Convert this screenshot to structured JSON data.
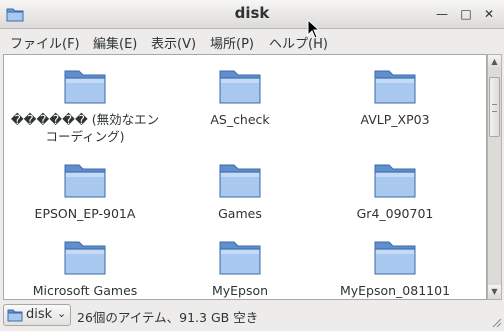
{
  "window": {
    "title": "disk"
  },
  "icons": {
    "folder": "folder-icon",
    "minimize": "minimize-icon",
    "maximize": "maximize-icon",
    "close": "close-icon"
  },
  "colors": {
    "folder_light": "#a8c8ef",
    "folder_dark": "#5f8fcc",
    "folder_edge": "#3d6aa8"
  },
  "window_controls": {
    "minimize": "—",
    "maximize": "□",
    "close": "✕"
  },
  "menu": [
    {
      "label": "ファイル(F)"
    },
    {
      "label": "編集(E)"
    },
    {
      "label": "表示(V)"
    },
    {
      "label": "場所(P)"
    },
    {
      "label": "ヘルプ(H)"
    }
  ],
  "files": [
    {
      "name": "������ (無効なエンコーディング)"
    },
    {
      "name": "AS_check"
    },
    {
      "name": "AVLP_XP03"
    },
    {
      "name": "EPSON_EP-901A"
    },
    {
      "name": "Games"
    },
    {
      "name": "Gr4_090701"
    },
    {
      "name": "Microsoft Games"
    },
    {
      "name": "MyEpson"
    },
    {
      "name": "MyEpson_081101"
    }
  ],
  "scrollbar": {
    "up": "▲",
    "down": "▼"
  },
  "statusbar": {
    "location": "disk",
    "chevron": "⌄",
    "summary": "26個のアイテム、91.3 GB 空き"
  }
}
